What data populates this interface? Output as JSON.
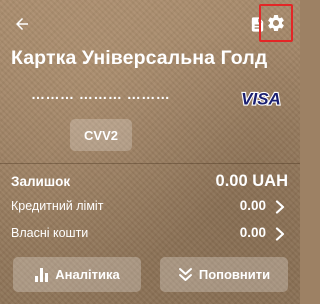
{
  "header": {
    "back_icon": "arrow-left-icon",
    "document_icon": "document-icon",
    "settings_icon": "gear-icon",
    "settings_highlight_color": "#e32626"
  },
  "card": {
    "title": "Картка Універсальна Голд",
    "number_masked": "……… ……… ………",
    "network_logo": "VISA",
    "network_logo_color": "#1a1f71",
    "cvv_label": "CVV2"
  },
  "balance": {
    "label": "Залишок",
    "value": "0.00 UAH"
  },
  "rows": [
    {
      "label": "Кредитний ліміт",
      "value": "0.00"
    },
    {
      "label": "Власні кошти",
      "value": "0.00"
    }
  ],
  "actions": {
    "analytics_label": "Аналітика",
    "analytics_icon": "bar-chart-icon",
    "topup_label": "Поповнити",
    "topup_icon": "double-chevron-down-icon"
  }
}
